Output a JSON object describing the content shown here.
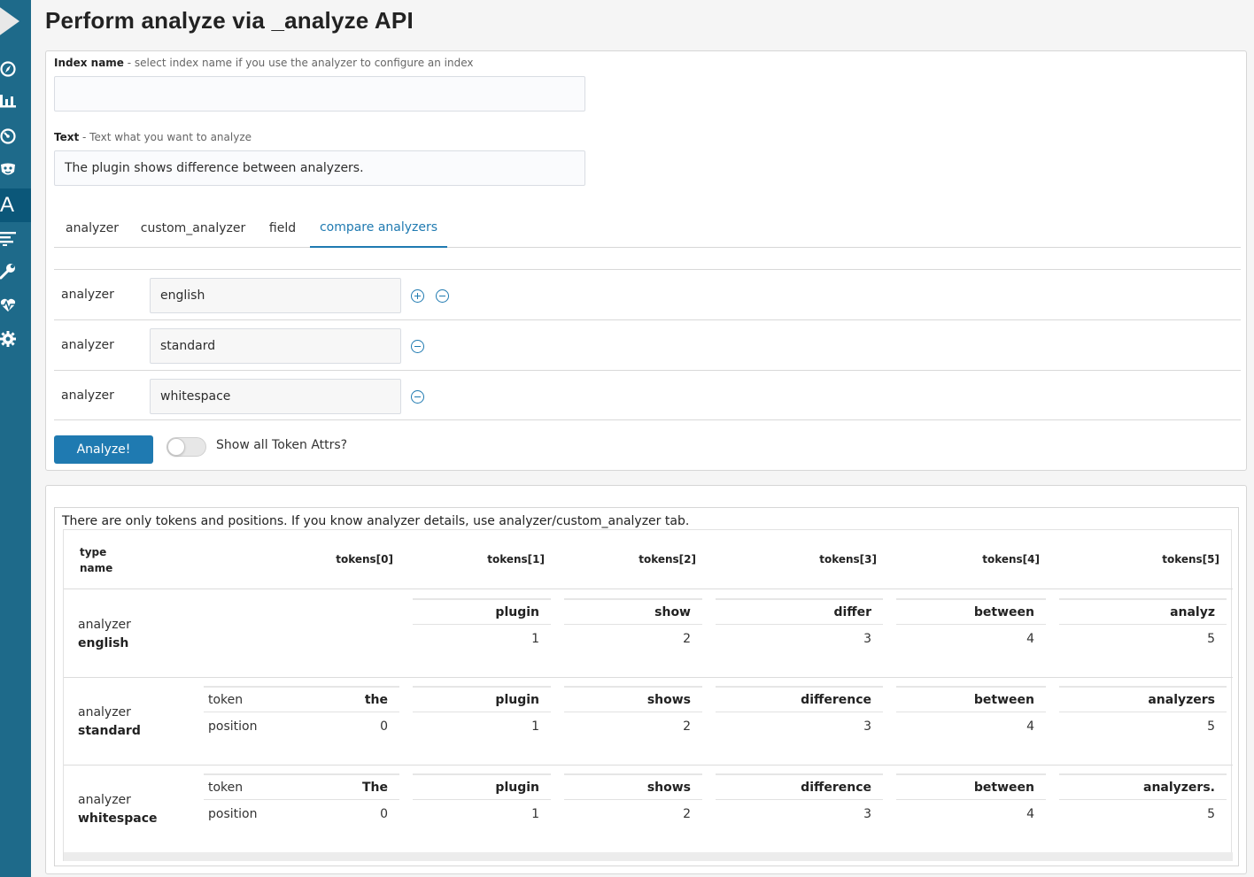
{
  "page": {
    "title": "Perform analyze via _analyze API"
  },
  "sidebar": {
    "items": [
      {
        "icon": "compass-icon"
      },
      {
        "icon": "bar-chart-icon"
      },
      {
        "icon": "speedometer-icon"
      },
      {
        "icon": "mask-icon"
      },
      {
        "icon": "analyze-plugin-icon",
        "letter": "A",
        "active": true
      },
      {
        "icon": "list-icon"
      },
      {
        "icon": "wrench-icon"
      },
      {
        "icon": "heartbeat-icon"
      },
      {
        "icon": "gear-icon"
      }
    ]
  },
  "form": {
    "index_label": "Index name",
    "index_hint": " - select index name if you use the analyzer to configure an index",
    "index_value": "",
    "text_label": "Text",
    "text_hint": " - Text what you want to analyze",
    "text_value": "The plugin shows difference between analyzers.",
    "tabs": [
      {
        "label": "analyzer"
      },
      {
        "label": "custom_analyzer"
      },
      {
        "label": "field"
      },
      {
        "label": "compare analyzers",
        "active": true
      }
    ],
    "analyzer_rows": [
      {
        "label": "analyzer",
        "value": "english"
      },
      {
        "label": "analyzer",
        "value": "standard"
      },
      {
        "label": "analyzer",
        "value": "whitespace"
      }
    ],
    "analyze_button": "Analyze!",
    "toggle_label": "Show all Token Attrs?",
    "toggle_on": false
  },
  "results": {
    "note": "There are only tokens and positions. If you know analyzer details, use analyzer/custom_analyzer tab.",
    "header": {
      "type_line1": "type",
      "type_line2": "name",
      "columns": [
        "tokens[0]",
        "tokens[1]",
        "tokens[2]",
        "tokens[3]",
        "tokens[4]",
        "tokens[5]"
      ]
    },
    "sub_labels": {
      "token": "token",
      "position": "position"
    },
    "rows": [
      {
        "type": "analyzer",
        "name": "english",
        "tokens": [
          null,
          {
            "token": "plugin",
            "position": "1"
          },
          {
            "token": "show",
            "position": "2"
          },
          {
            "token": "differ",
            "position": "3"
          },
          {
            "token": "between",
            "position": "4"
          },
          {
            "token": "analyz",
            "position": "5"
          }
        ]
      },
      {
        "type": "analyzer",
        "name": "standard",
        "tokens": [
          {
            "token": "the",
            "position": "0"
          },
          {
            "token": "plugin",
            "position": "1"
          },
          {
            "token": "shows",
            "position": "2"
          },
          {
            "token": "difference",
            "position": "3"
          },
          {
            "token": "between",
            "position": "4"
          },
          {
            "token": "analyzers",
            "position": "5"
          }
        ]
      },
      {
        "type": "analyzer",
        "name": "whitespace",
        "tokens": [
          {
            "token": "The",
            "position": "0"
          },
          {
            "token": "plugin",
            "position": "1"
          },
          {
            "token": "shows",
            "position": "2"
          },
          {
            "token": "difference",
            "position": "3"
          },
          {
            "token": "between",
            "position": "4"
          },
          {
            "token": "analyzers.",
            "position": "5"
          }
        ]
      }
    ]
  },
  "colors": {
    "sidebar": "#1e6a8a",
    "sidebar_active": "#0b5779",
    "accent": "#1f7ab1"
  }
}
